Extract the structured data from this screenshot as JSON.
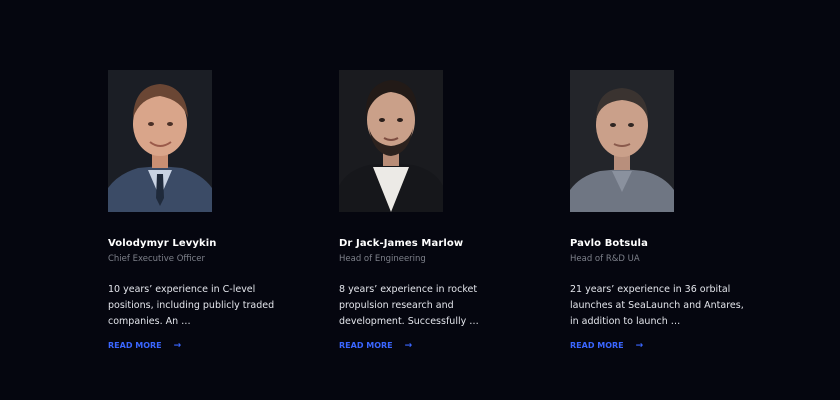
{
  "team": [
    {
      "name": "Volodymyr Levykin",
      "role": "Chief Executive Officer",
      "bio": "10 years’ experience in C-level positions, including publicly traded companies. An …",
      "cta": "READ MORE",
      "photo": {
        "icon": "portrait-photo",
        "bg": "#1b1e25",
        "suit": "#3b4b66",
        "skin": "#d9a58a",
        "hair": "#6a4634",
        "shirt": "#c9d3e3"
      }
    },
    {
      "name": "Dr Jack-James Marlow",
      "role": "Head of Engineering",
      "bio": "8 years’ experience in rocket propulsion research and development. Successfully …",
      "cta": "READ MORE",
      "photo": {
        "icon": "portrait-photo",
        "bg": "#1a1b1f",
        "suit": "#16171b",
        "skin": "#caa089",
        "hair": "#221a17",
        "shirt": "#eceae6"
      }
    },
    {
      "name": "Pavlo Botsula",
      "role": "Head of R&D UA",
      "bio": "21 years’ experience in 36 orbital launches at SeaLaunch and Antares, in addition to launch …",
      "cta": "READ MORE",
      "photo": {
        "icon": "portrait-photo",
        "bg": "#23252a",
        "suit": "#6f7683",
        "skin": "#caa08a",
        "hair": "#3a3330",
        "shirt": "#8a919e"
      }
    }
  ],
  "colors": {
    "background": "#05060f",
    "accent": "#3a66ff",
    "name": "#ffffff",
    "role": "#7d808a",
    "bio": "#e4e6ec"
  },
  "icons": {
    "cta_arrow": "arrow-right-icon"
  }
}
